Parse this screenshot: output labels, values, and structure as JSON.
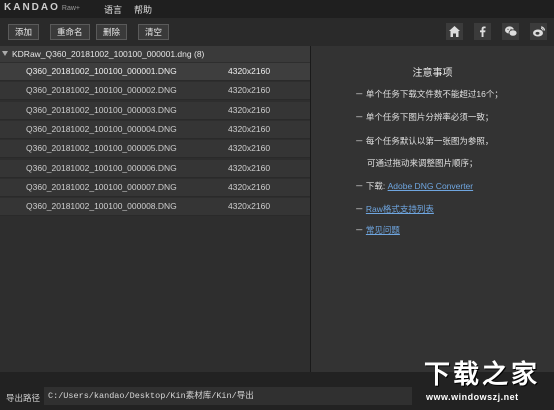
{
  "app": {
    "logo": "KANDAO",
    "logo_sub": "Raw+"
  },
  "menu": [
    {
      "label": "语言"
    },
    {
      "label": "帮助"
    }
  ],
  "toolbar": {
    "add": "添加",
    "rename": "重命名",
    "delete": "删除",
    "clear": "清空"
  },
  "social_icons": [
    "home-icon",
    "facebook-icon",
    "wechat-icon",
    "weibo-icon"
  ],
  "task": {
    "name": "KDRaw_Q360_20181002_100100_000001.dng",
    "count": "(8)"
  },
  "files": [
    {
      "name": "Q360_20181002_100100_000001.DNG",
      "size": "4320x2160",
      "selected": true
    },
    {
      "name": "Q360_20181002_100100_000002.DNG",
      "size": "4320x2160"
    },
    {
      "name": "Q360_20181002_100100_000003.DNG",
      "size": "4320x2160"
    },
    {
      "name": "Q360_20181002_100100_000004.DNG",
      "size": "4320x2160"
    },
    {
      "name": "Q360_20181002_100100_000005.DNG",
      "size": "4320x2160"
    },
    {
      "name": "Q360_20181002_100100_000006.DNG",
      "size": "4320x2160"
    },
    {
      "name": "Q360_20181002_100100_000007.DNG",
      "size": "4320x2160"
    },
    {
      "name": "Q360_20181002_100100_000008.DNG",
      "size": "4320x2160"
    }
  ],
  "notice": {
    "title": "注意事项",
    "items": [
      "－ 单个任务下载文件数不能超过16个；",
      "－ 单个任务下图片分辨率必须一致；",
      "－ 每个任务默认以第一张图为参照，",
      "可通过拖动来调整图片顺序；"
    ],
    "download_prefix": "－ 下载:",
    "download_link": "Adobe DNG Converter",
    "link_raw": "Raw格式支持列表",
    "link_faq": "常见问题"
  },
  "status": {
    "label": "导出路径",
    "path": "C:/Users/kandao/Desktop/Kin素材库/Kin/导出"
  },
  "watermark": {
    "text": "下载之家",
    "url": "www.windowszj.net"
  },
  "colors": {
    "link": "#6fa6e0",
    "selected_row": "#3e3e3e",
    "row": "#353535"
  }
}
